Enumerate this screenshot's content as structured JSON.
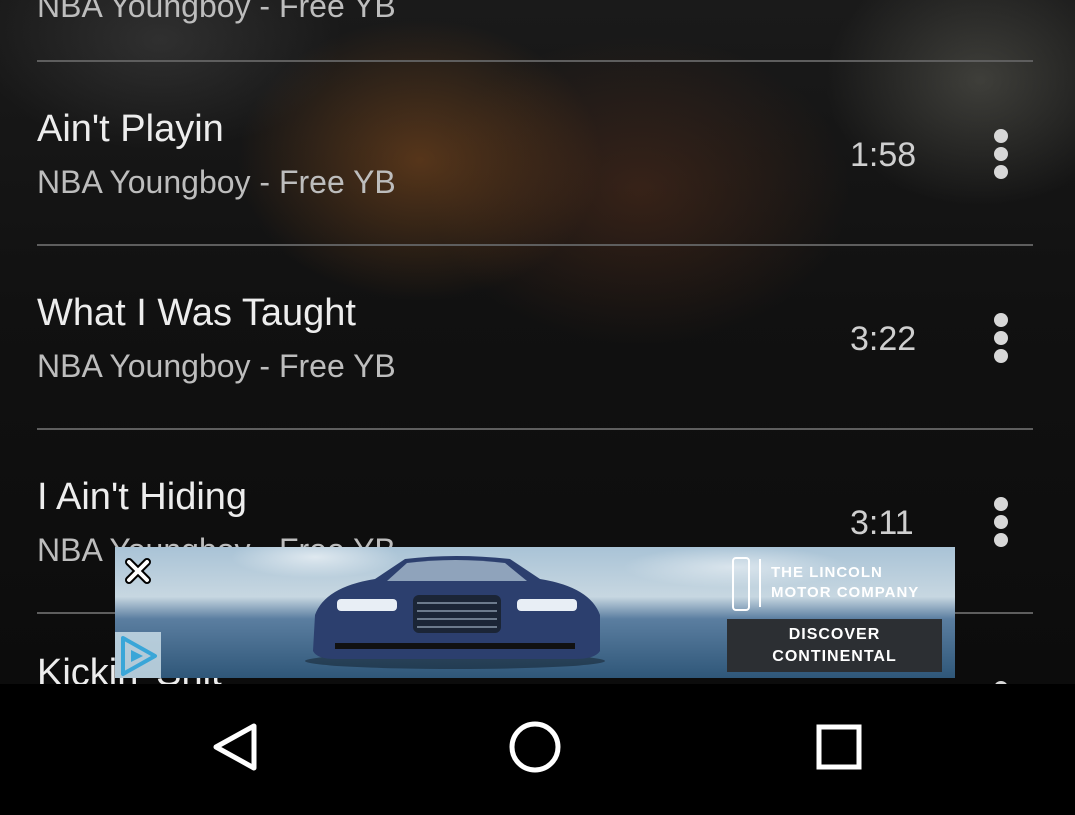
{
  "songs": [
    {
      "title": "",
      "artist": "NBA Youngboy - Free YB",
      "duration": ""
    },
    {
      "title": "Ain't Playin",
      "artist": "NBA Youngboy - Free YB",
      "duration": "1:58"
    },
    {
      "title": "What I Was Taught",
      "artist": "NBA Youngboy - Free YB",
      "duration": "3:22"
    },
    {
      "title": "I Ain't Hiding",
      "artist": "NBA Youngboy - Free YB",
      "duration": "3:11"
    },
    {
      "title": "Kickin' Shit",
      "artist": "",
      "duration": ""
    }
  ],
  "ad": {
    "brand_line1": "THE LINCOLN",
    "brand_line2": "MOTOR COMPANY",
    "cta_line1": "DISCOVER",
    "cta_line2": "CONTINENTAL"
  },
  "navbar": {
    "back_icon": "back-triangle-icon",
    "home_icon": "home-circle-icon",
    "recents_icon": "recents-square-icon"
  }
}
